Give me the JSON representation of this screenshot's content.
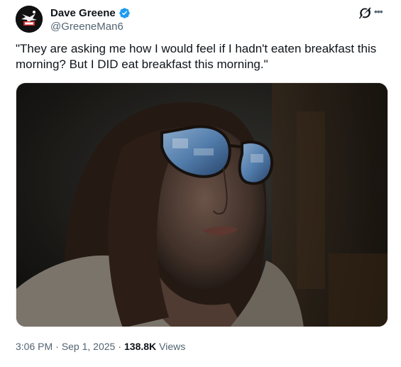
{
  "author": {
    "display_name": "Dave Greene",
    "handle": "@GreeneMan6",
    "verified": true,
    "avatar_icon": "avatar-image",
    "verified_icon": "verified-badge-icon",
    "verified_color": "#1d9bf0"
  },
  "header_icons": {
    "grok": "grok-icon",
    "more": "more-options-icon"
  },
  "tweet": {
    "text": "\"They are asking me how I would feel if I hadn't eaten breakfast this morning? But I DID eat breakfast this morning.\"",
    "media_description_icon": "video-still-image"
  },
  "meta": {
    "time": "3:06 PM",
    "separator": "·",
    "date": "Sep 1, 2025",
    "view_count": "138.8K",
    "views_label": "Views"
  },
  "colors": {
    "text_primary": "#0f1419",
    "text_secondary": "#536471",
    "accent": "#1d9bf0"
  }
}
